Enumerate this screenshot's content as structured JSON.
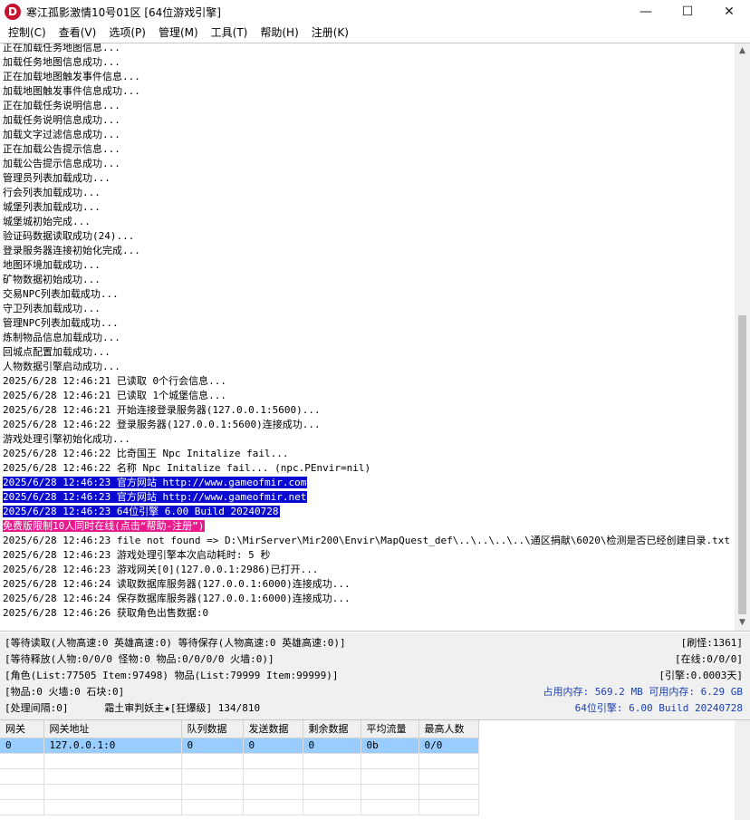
{
  "window": {
    "title": "寒江孤影激情10号01区 [64位游戏引擎]",
    "icon_letter": "D",
    "minimize_glyph": "—",
    "maximize_glyph": "☐",
    "close_glyph": "✕"
  },
  "menu": [
    {
      "label": "控制(C)"
    },
    {
      "label": "查看(V)"
    },
    {
      "label": "选项(P)"
    },
    {
      "label": "管理(M)"
    },
    {
      "label": "工具(T)"
    },
    {
      "label": "帮助(H)"
    },
    {
      "label": "注册(K)"
    }
  ],
  "log": [
    {
      "text": "正在加载任务地图信息...",
      "hl": ""
    },
    {
      "text": "加载任务地图信息成功...",
      "hl": ""
    },
    {
      "text": "正在加载地图触发事件信息...",
      "hl": ""
    },
    {
      "text": "加载地图触发事件信息成功...",
      "hl": ""
    },
    {
      "text": "正在加载任务说明信息...",
      "hl": ""
    },
    {
      "text": "加载任务说明信息成功...",
      "hl": ""
    },
    {
      "text": "加载文字过滤信息成功...",
      "hl": ""
    },
    {
      "text": "正在加载公告提示信息...",
      "hl": ""
    },
    {
      "text": "加载公告提示信息成功...",
      "hl": ""
    },
    {
      "text": "管理员列表加载成功...",
      "hl": ""
    },
    {
      "text": "行会列表加载成功...",
      "hl": ""
    },
    {
      "text": "城堡列表加载成功...",
      "hl": ""
    },
    {
      "text": "城堡城初始完成...",
      "hl": ""
    },
    {
      "text": "验证码数据读取成功(24)...",
      "hl": ""
    },
    {
      "text": "登录服务器连接初始化完成...",
      "hl": ""
    },
    {
      "text": "地图环境加载成功...",
      "hl": ""
    },
    {
      "text": "矿物数据初始成功...",
      "hl": ""
    },
    {
      "text": "交易NPC列表加载成功...",
      "hl": ""
    },
    {
      "text": "守卫列表加载成功...",
      "hl": ""
    },
    {
      "text": "管理NPC列表加载成功...",
      "hl": ""
    },
    {
      "text": "炼制物品信息加载成功...",
      "hl": ""
    },
    {
      "text": "回城点配置加载成功...",
      "hl": ""
    },
    {
      "text": "人物数据引擎启动成功...",
      "hl": ""
    },
    {
      "text": "2025/6/28 12:46:21 已读取 0个行会信息...",
      "hl": ""
    },
    {
      "text": "2025/6/28 12:46:21 已读取 1个城堡信息...",
      "hl": ""
    },
    {
      "text": "2025/6/28 12:46:21 开始连接登录服务器(127.0.0.1:5600)...",
      "hl": ""
    },
    {
      "text": "2025/6/28 12:46:22 登录服务器(127.0.0.1:5600)连接成功...",
      "hl": ""
    },
    {
      "text": "游戏处理引擎初始化成功...",
      "hl": ""
    },
    {
      "text": "2025/6/28 12:46:22 比奇国王 Npc Initalize fail...",
      "hl": ""
    },
    {
      "text": "2025/6/28 12:46:22 名称 Npc Initalize fail... (npc.PEnvir=nil)",
      "hl": ""
    },
    {
      "text": "2025/6/28 12:46:23 官方网站 http://www.gameofmir.com",
      "hl": "blue"
    },
    {
      "text": "2025/6/28 12:46:23 官方网站 http://www.gameofmir.net",
      "hl": "blue"
    },
    {
      "text": "2025/6/28 12:46:23 64位引擎 6.00 Build 20240728",
      "hl": "blue"
    },
    {
      "text": "免费版限制10人同时在线(点击“帮助-注册”)",
      "hl": "pink"
    },
    {
      "text": "2025/6/28 12:46:23 file not found => D:\\MirServer\\Mir200\\Envir\\MapQuest_def\\..\\..\\..\\..\\通区捐献\\6020\\检测是否已经创建目录.txt",
      "hl": ""
    },
    {
      "text": "2025/6/28 12:46:23 游戏处理引擎本次启动耗时: 5 秒",
      "hl": ""
    },
    {
      "text": "2025/6/28 12:46:23 游戏网关[0](127.0.0.1:2986)已打开...",
      "hl": ""
    },
    {
      "text": "2025/6/28 12:46:24 读取数据库服务器(127.0.0.1:6000)连接成功...",
      "hl": ""
    },
    {
      "text": "2025/6/28 12:46:24 保存数据库服务器(127.0.0.1:6000)连接成功...",
      "hl": ""
    },
    {
      "text": "2025/6/28 12:46:26 获取角色出售数据:0",
      "hl": ""
    }
  ],
  "status": {
    "row1_left": "[等待读取(人物高速:0 英雄高速:0) 等待保存(人物高速:0 英雄高速:0)]",
    "row1_right": "[刷怪:1361]",
    "row2_left": "[等待释放(人物:0/0/0 怪物:0 物品:0/0/0/0 火墙:0)]",
    "row2_right": "[在线:0/0/0]",
    "row3_left": "[角色(List:77505 Item:97498) 物品(List:79999 Item:99999)]",
    "row3_right": "[引擎:0.0003天]",
    "row4_left": "[物品:0 火墙:0 石块:0]",
    "row4_right": "占用内存: 569.2 MB 可用内存: 6.29 GB",
    "row5_left": "[处理间隔:0]      霜土审判妖主★[狂爆级] 134/810",
    "row5_right": "64位引擎: 6.00 Build 20240728"
  },
  "grid": {
    "headers": [
      "网关",
      "网关地址",
      "队列数据",
      "发送数据",
      "剩余数据",
      "平均流量",
      "最高人数"
    ],
    "rows": [
      [
        "0",
        "127.0.0.1:0",
        "0",
        "0",
        "0",
        "0b",
        "0/0"
      ]
    ]
  },
  "colors": {
    "highlight_blue": "#0a0ad0",
    "highlight_pink": "#e81a8c",
    "selected_row": "#99ccff",
    "memory_text": "#1a3fb0"
  }
}
